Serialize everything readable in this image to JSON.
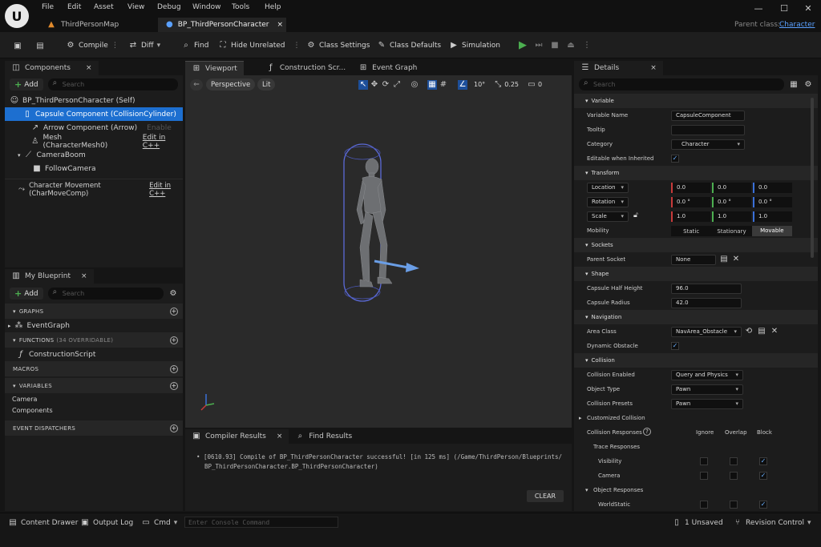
{
  "menu": [
    "File",
    "Edit",
    "Asset",
    "View",
    "Debug",
    "Window",
    "Tools",
    "Help"
  ],
  "doc_tabs": {
    "map": "ThirdPersonMap",
    "blueprint": "BP_ThirdPersonCharacter",
    "close": "×"
  },
  "parent_class": {
    "label": "Parent class:",
    "value": "Character"
  },
  "window_buttons": {
    "min": "—",
    "max": "☐",
    "close": "✕"
  },
  "toolbar": {
    "compile": "Compile",
    "diff": "Diff",
    "find": "Find",
    "hide_unrelated": "Hide Unrelated",
    "class_settings": "Class Settings",
    "class_defaults": "Class Defaults",
    "simulation": "Simulation"
  },
  "components": {
    "tab": "Components",
    "add": "Add",
    "search_placeholder": "Search",
    "root": "BP_ThirdPersonCharacter (Self)",
    "items": [
      {
        "label": "Capsule Component (CollisionCylinder)",
        "extra": ""
      },
      {
        "label": "Arrow Component (Arrow)",
        "extra": "Enable"
      },
      {
        "label": "Mesh (CharacterMesh0)",
        "extra": "Edit in C++"
      },
      {
        "label": "CameraBoom",
        "extra": ""
      },
      {
        "label": "FollowCamera",
        "extra": ""
      },
      {
        "label": "Character Movement (CharMoveComp)",
        "extra": "Edit in C++"
      }
    ]
  },
  "my_blueprint": {
    "tab": "My Blueprint",
    "add": "Add",
    "search_placeholder": "Search",
    "graphs": "GRAPHS",
    "event_graph": "EventGraph",
    "functions": "FUNCTIONS",
    "functions_count": "(34 OVERRIDABLE)",
    "construction_script": "ConstructionScript",
    "macros": "MACROS",
    "variables": "VARIABLES",
    "var_camera": "Camera",
    "var_components": "Components",
    "dispatchers": "EVENT DISPATCHERS"
  },
  "center_tabs": {
    "viewport": "Viewport",
    "construction": "Construction Scr...",
    "event_graph": "Event Graph"
  },
  "viewport": {
    "perspective": "Perspective",
    "lit": "Lit",
    "angle": "10°",
    "scale": "0.25",
    "cam": "0"
  },
  "bottom_tabs": {
    "compiler": "Compiler Results",
    "find": "Find Results"
  },
  "compiler": {
    "line1": "• [0610.93] Compile of BP_ThirdPersonCharacter successful! [in 125 ms] (/Game/ThirdPerson/Blueprints/",
    "line2": "BP_ThirdPersonCharacter.BP_ThirdPersonCharacter)",
    "clear": "CLEAR"
  },
  "details": {
    "tab": "Details",
    "search_placeholder": "Search",
    "variable": "Variable",
    "variable_name_label": "Variable Name",
    "variable_name": "CapsuleComponent",
    "tooltip_label": "Tooltip",
    "tooltip": "",
    "category_label": "Category",
    "category": "Character",
    "editable_label": "Editable when Inherited",
    "transform": "Transform",
    "location": "Location",
    "location_vals": [
      "0.0",
      "0.0",
      "0.0"
    ],
    "rotation": "Rotation",
    "rotation_vals": [
      "0.0 °",
      "0.0 °",
      "0.0 °"
    ],
    "scale": "Scale",
    "scale_vals": [
      "1.0",
      "1.0",
      "1.0"
    ],
    "mobility_label": "Mobility",
    "mobility": [
      "Static",
      "Stationary",
      "Movable"
    ],
    "sockets": "Sockets",
    "parent_socket_label": "Parent Socket",
    "parent_socket": "None",
    "shape": "Shape",
    "half_height_label": "Capsule Half Height",
    "half_height": "96.0",
    "radius_label": "Capsule Radius",
    "radius": "42.0",
    "navigation": "Navigation",
    "area_class_label": "Area Class",
    "area_class": "NavArea_Obstacle",
    "dynamic_obstacle_label": "Dynamic Obstacle",
    "collision": "Collision",
    "collision_enabled_label": "Collision Enabled",
    "collision_enabled": "Query and Physics",
    "object_type_label": "Object Type",
    "object_type": "Pawn",
    "presets_label": "Collision Presets",
    "presets": "Pawn",
    "customized": "Customized Collision",
    "responses_label": "Collision Responses",
    "resp_cols": [
      "Ignore",
      "Overlap",
      "Block"
    ],
    "trace_responses": "Trace Responses",
    "visibility": "Visibility",
    "camera": "Camera",
    "object_responses": "Object Responses",
    "world_static": "WorldStatic"
  },
  "statusbar": {
    "content_drawer": "Content Drawer",
    "output_log": "Output Log",
    "cmd": "Cmd",
    "console_placeholder": "Enter Console Command",
    "unsaved": "1 Unsaved",
    "revision": "Revision Control"
  },
  "colors": {
    "accent": "#1d6fd0",
    "play": "#4caf50",
    "x_axis": "#c83a3a",
    "y_axis": "#4caf50",
    "z_axis": "#3a6fd8"
  }
}
